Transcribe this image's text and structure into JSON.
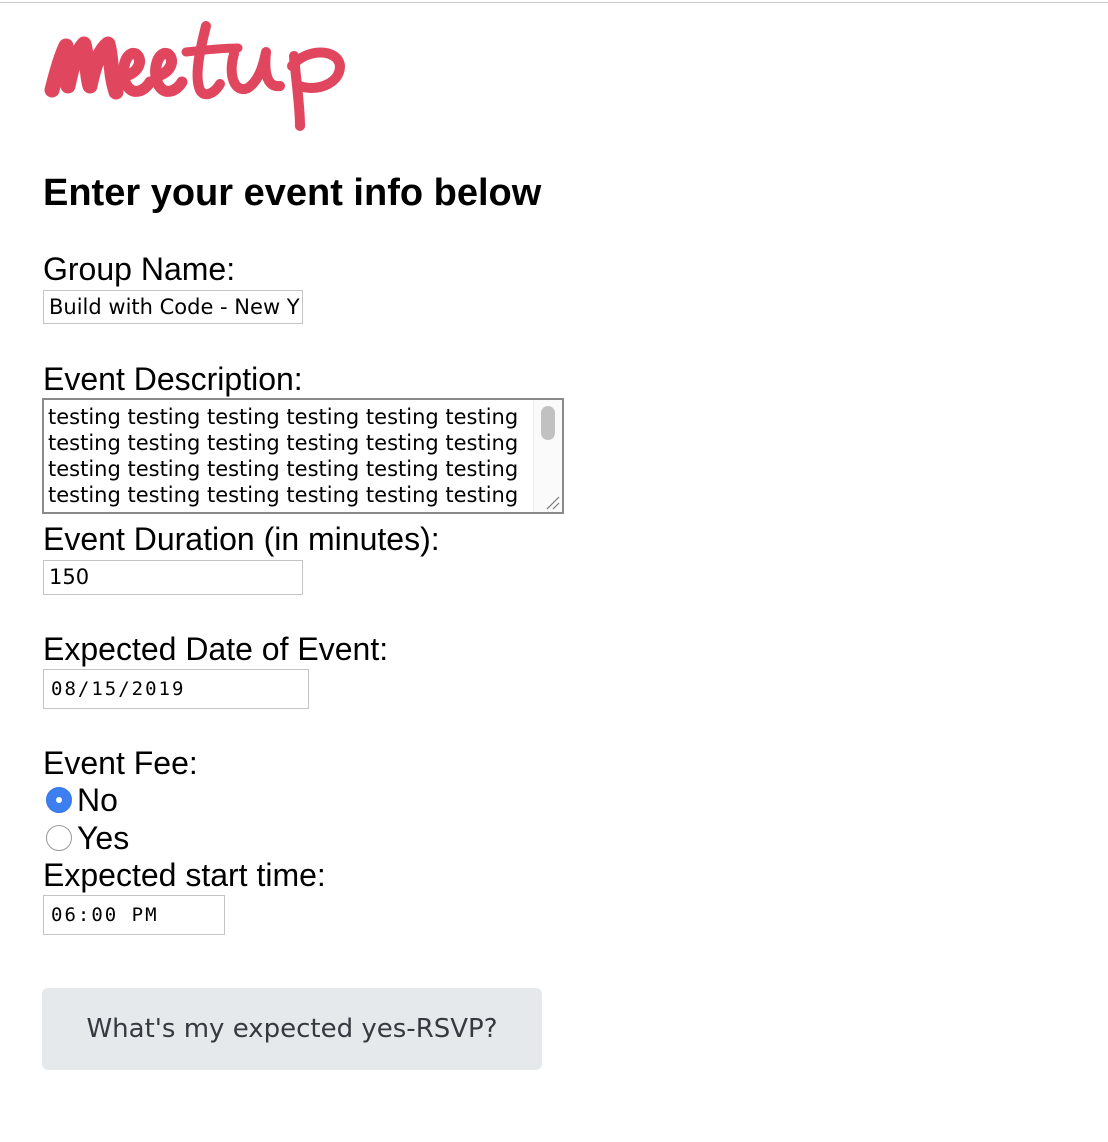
{
  "brand": {
    "logo_text": "Meetup",
    "logo_color": "#e0465e"
  },
  "heading": "Enter your event info below",
  "form": {
    "group_name": {
      "label": "Group Name:",
      "value": "Build with Code - New Y"
    },
    "description": {
      "label": "Event Description:",
      "lines": [
        "testing testing testing testing testing testing",
        "testing testing testing testing testing testing",
        "testing testing testing testing testing testing",
        "testing testing testing testing testing testing"
      ]
    },
    "duration": {
      "label": "Event Duration (in minutes):",
      "value": "150"
    },
    "date": {
      "label": "Expected Date of Event:",
      "value": "08/15/2019"
    },
    "fee": {
      "label": "Event Fee:",
      "options": [
        {
          "label": "No",
          "checked": true
        },
        {
          "label": "Yes",
          "checked": false
        }
      ]
    },
    "start_time": {
      "label": "Expected start time:",
      "value": "06:00 PM"
    }
  },
  "submit_button": {
    "label": "What's my expected yes-RSVP?"
  },
  "colors": {
    "radio_checked": "#3d7ff0",
    "button_bg": "#e6e9ec",
    "button_text": "#343a40"
  }
}
